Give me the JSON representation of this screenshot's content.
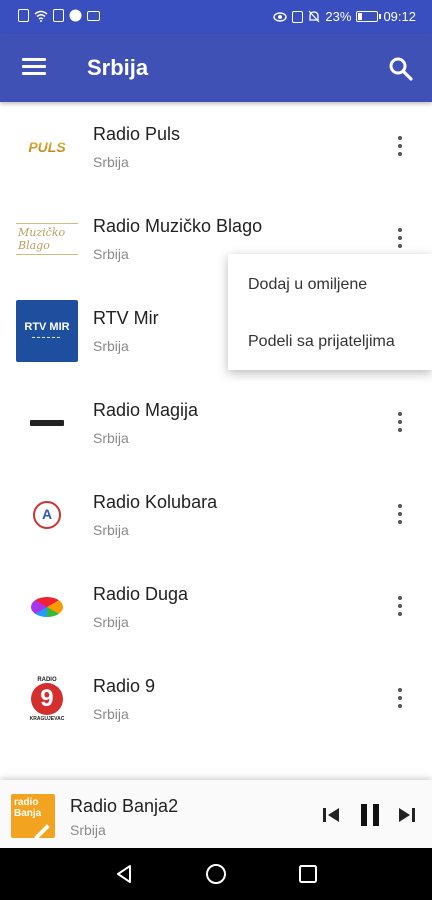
{
  "status_bar": {
    "battery_percent": "23%",
    "time": "09:12",
    "left_icons": [
      "notification-icon",
      "wifi-icon",
      "gallery-icon",
      "messenger-icon",
      "screen-icon"
    ],
    "right_icons": [
      "eye-comfort-icon",
      "nfc-icon",
      "mute-icon",
      "battery-icon"
    ],
    "battery_level": 0.23
  },
  "app_bar": {
    "title": "Srbija",
    "menu_icon": "hamburger-menu-icon",
    "search_icon": "search-icon"
  },
  "stations": [
    {
      "name": "Radio Puls",
      "subtitle": "Srbija",
      "logo_text": "PULS"
    },
    {
      "name": "Radio Muzičko Blago",
      "subtitle": "Srbija",
      "logo_text": "Muzičko Blago"
    },
    {
      "name": "RTV Mir",
      "subtitle": "Srbija",
      "logo_text": "RTV MIR"
    },
    {
      "name": "Radio Magija",
      "subtitle": "Srbija"
    },
    {
      "name": "Radio Kolubara",
      "subtitle": "Srbija"
    },
    {
      "name": "Radio Duga",
      "subtitle": "Srbija"
    },
    {
      "name": "Radio 9",
      "subtitle": "Srbija",
      "logo_text_top": "RADIO",
      "logo_number": "9",
      "logo_text_bottom": "KRAGUJEVAC"
    }
  ],
  "popup_menu": {
    "items": [
      "Dodaj u omiljene",
      "Podeli sa prijateljima"
    ]
  },
  "player": {
    "station": "Radio Banja2",
    "subtitle": "Srbija",
    "logo_text_line1": "radio",
    "logo_text_line2": "Banja"
  },
  "colors": {
    "app_bar": "#3f51b5",
    "status_bar": "#3a4fbf",
    "navigation_bar": "#000000",
    "player_logo": "#f2a31f"
  }
}
